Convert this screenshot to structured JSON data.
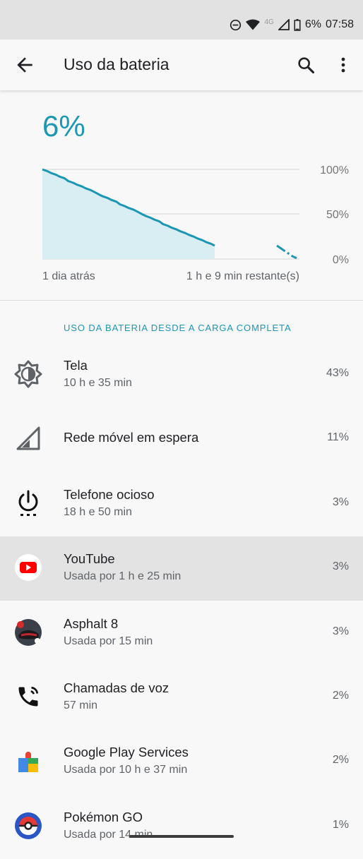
{
  "status_bar": {
    "battery_text": "6%",
    "time": "07:58",
    "network_label": "4G",
    "icons": [
      "do-not-disturb-icon",
      "wifi-icon",
      "signal-icon",
      "battery-icon"
    ]
  },
  "app_bar": {
    "title": "Uso da bateria",
    "icons": [
      "back-arrow-icon",
      "search-icon",
      "more-vert-icon"
    ]
  },
  "battery": {
    "level": "6%",
    "accent_color": "#1b97b3"
  },
  "chart_data": {
    "type": "area",
    "y_ticks": [
      "100%",
      "50%",
      "0%"
    ],
    "ylim": [
      0,
      100
    ],
    "x_start_label": "1 dia atrás",
    "x_end_label": "1 h e 9 min restante(s)",
    "series": [
      {
        "values_history": [
          100,
          98,
          96,
          94,
          92,
          90,
          87,
          85,
          83,
          81,
          79,
          77,
          75,
          72,
          70,
          68,
          66,
          64,
          61,
          59,
          57,
          55,
          53,
          50,
          48,
          46,
          44,
          42,
          39,
          37,
          35,
          33,
          31,
          29,
          27,
          25,
          23,
          21,
          19,
          17,
          15
        ],
        "values_projection": [
          15,
          12,
          9,
          6,
          3,
          1
        ]
      }
    ]
  },
  "section": {
    "header": "USO DA BATERIA DESDE A CARGA COMPLETA"
  },
  "items": [
    {
      "title": "Tela",
      "subtitle": "10 h e 35 min",
      "percent": "43%",
      "icon": "brightness-icon"
    },
    {
      "title": "Rede móvel em espera",
      "subtitle": "",
      "percent": "11%",
      "icon": "cell-signal-icon"
    },
    {
      "title": "Telefone ocioso",
      "subtitle": "18 h e 50 min",
      "percent": "3%",
      "icon": "power-idle-icon"
    },
    {
      "title": "YouTube",
      "subtitle": "Usada por 1 h e 25 min",
      "percent": "3%",
      "icon": "youtube-icon"
    },
    {
      "title": "Asphalt 8",
      "subtitle": "Usada por 15 min",
      "percent": "3%",
      "icon": "asphalt-8-icon"
    },
    {
      "title": "Chamadas de voz",
      "subtitle": "57 min",
      "percent": "2%",
      "icon": "phone-call-icon"
    },
    {
      "title": "Google Play Services",
      "subtitle": "Usada por 10 h e 37 min",
      "percent": "2%",
      "icon": "puzzle-piece-icon"
    },
    {
      "title": "Pokémon GO",
      "subtitle": "Usada por 14 min",
      "percent": "1%",
      "icon": "pokeball-icon"
    }
  ]
}
